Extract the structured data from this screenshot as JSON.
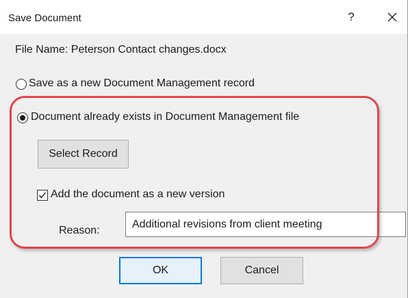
{
  "dialog": {
    "title": "Save Document",
    "help_label": "?",
    "close_icon": "close-icon"
  },
  "file_name_label": "File Name: Peterson Contact changes.docx",
  "options": {
    "new_record_label": "Save as a new Document Management record",
    "new_record_selected": false,
    "existing_label": "Document already exists in Document Management file",
    "existing_selected": true
  },
  "select_record_label": "Select Record",
  "new_version": {
    "label": "Add the document as a new version",
    "checked": true
  },
  "reason": {
    "label": "Reason:",
    "value": "Additional revisions from client meeting"
  },
  "buttons": {
    "ok_label": "OK",
    "cancel_label": "Cancel"
  },
  "colors": {
    "highlight": "#e0454d",
    "default_button_border": "#0078d7"
  }
}
